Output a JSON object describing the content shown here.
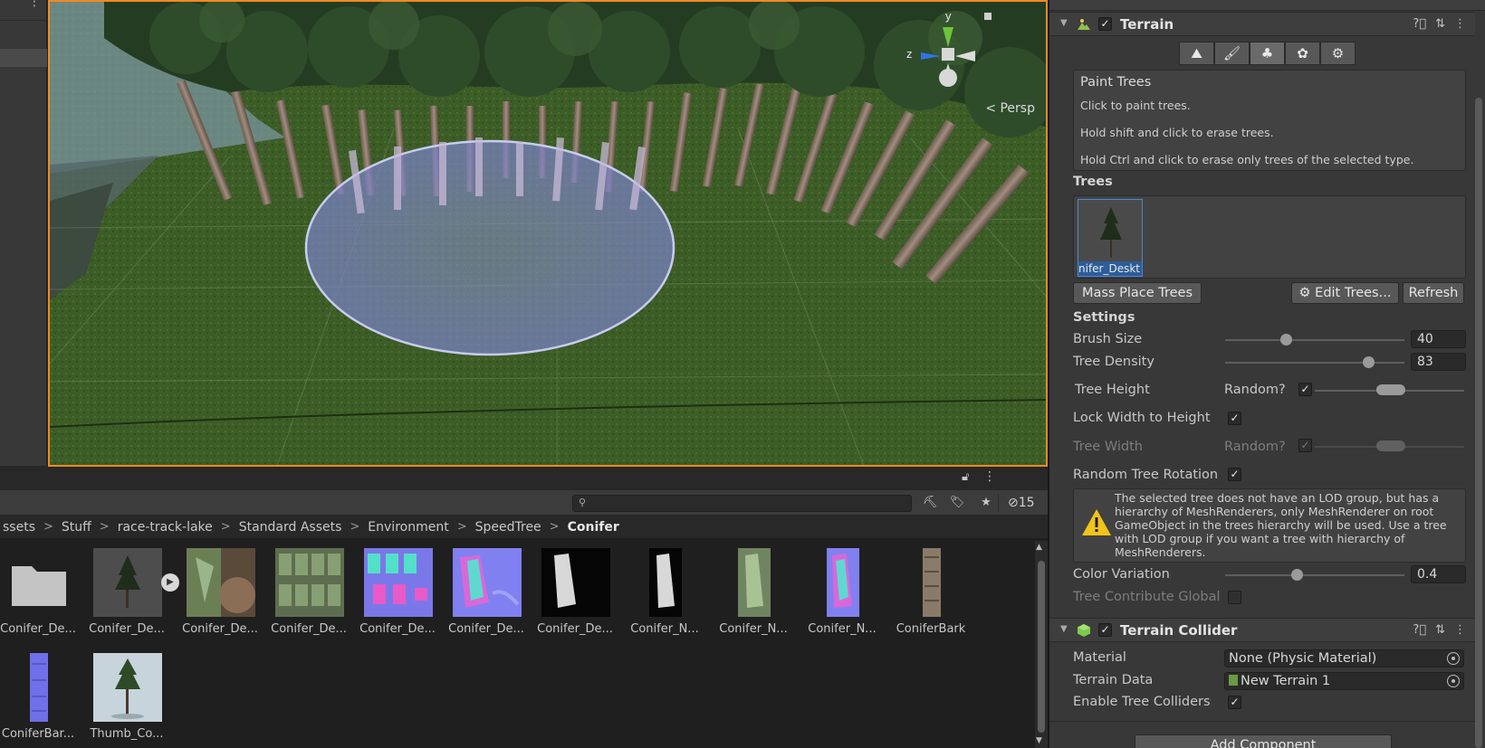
{
  "scene": {
    "persp_label": "< Persp",
    "gizmo_axes": {
      "y": "y",
      "z": "z"
    }
  },
  "project": {
    "hidden_count": "15",
    "search_value": "",
    "breadcrumb": [
      "ssets",
      "Stuff",
      "race-track-lake",
      "Standard Assets",
      "Environment",
      "SpeedTree",
      "Conifer"
    ],
    "assets_row1": [
      {
        "label": "Conifer_De...",
        "kind": "folder"
      },
      {
        "label": "Conifer_De...",
        "kind": "tree-prefab"
      },
      {
        "label": "Conifer_De...",
        "kind": "texture-bark"
      },
      {
        "label": "Conifer_De...",
        "kind": "texture-leaves"
      },
      {
        "label": "Conifer_De...",
        "kind": "texture-atlas"
      },
      {
        "label": "Conifer_De...",
        "kind": "normal-map"
      },
      {
        "label": "Conifer_De...",
        "kind": "mask-black"
      },
      {
        "label": "Conifer_N...",
        "kind": "mask-black-narrow"
      },
      {
        "label": "Conifer_N...",
        "kind": "texture-green-narrow"
      },
      {
        "label": "Conifer_N...",
        "kind": "normal-narrow"
      },
      {
        "label": "ConiferBark",
        "kind": "bark-strip"
      }
    ],
    "assets_row2": [
      {
        "label": "ConiferBar...",
        "kind": "bark-normal-strip"
      },
      {
        "label": "Thumb_Co...",
        "kind": "thumbnail"
      }
    ]
  },
  "inspector": {
    "terrain": {
      "title": "Terrain",
      "enabled": true,
      "tools": [
        "raise-lower",
        "paint-texture",
        "paint-trees",
        "paint-details",
        "settings"
      ],
      "help_title": "Paint Trees",
      "help_lines": [
        "Click to paint trees.",
        "Hold shift and click to erase trees.",
        "Hold Ctrl and click to erase only trees of the selected type."
      ],
      "trees_label": "Trees",
      "selected_tree_caption": "nifer_Deskt",
      "mass_place_label": "Mass Place Trees",
      "edit_trees_label": "Edit Trees...",
      "refresh_label": "Refresh",
      "settings_label": "Settings",
      "brush_size_label": "Brush Size",
      "brush_size_value": "40",
      "brush_size_fraction": 0.34,
      "tree_density_label": "Tree Density",
      "tree_density_value": "83",
      "tree_density_fraction": 0.8,
      "tree_height_label": "Tree Height",
      "random_label": "Random?",
      "lock_width_label": "Lock Width to Height",
      "tree_width_label": "Tree Width",
      "random_rotation_label": "Random Tree Rotation",
      "lod_warning": "The selected tree does not have an LOD group, but has a hierarchy of MeshRenderers, only MeshRenderer on root GameObject in the trees hierarchy will be used. Use a tree with LOD group if you want a tree with hierarchy of MeshRenderers.",
      "color_variation_label": "Color Variation",
      "color_variation_value": "0.4",
      "color_variation_fraction": 0.4,
      "contribute_gi_label": "Tree Contribute Global"
    },
    "collider": {
      "title": "Terrain Collider",
      "enabled": true,
      "material_label": "Material",
      "material_value": "None (Physic Material)",
      "terrain_data_label": "Terrain Data",
      "terrain_data_value": "New Terrain 1",
      "enable_tree_colliders_label": "Enable Tree Colliders"
    },
    "add_component_label": "Add Component"
  },
  "colors": {
    "accent_orange": "#f08a24",
    "selection_blue": "#2c5d99",
    "panel": "#383838"
  }
}
